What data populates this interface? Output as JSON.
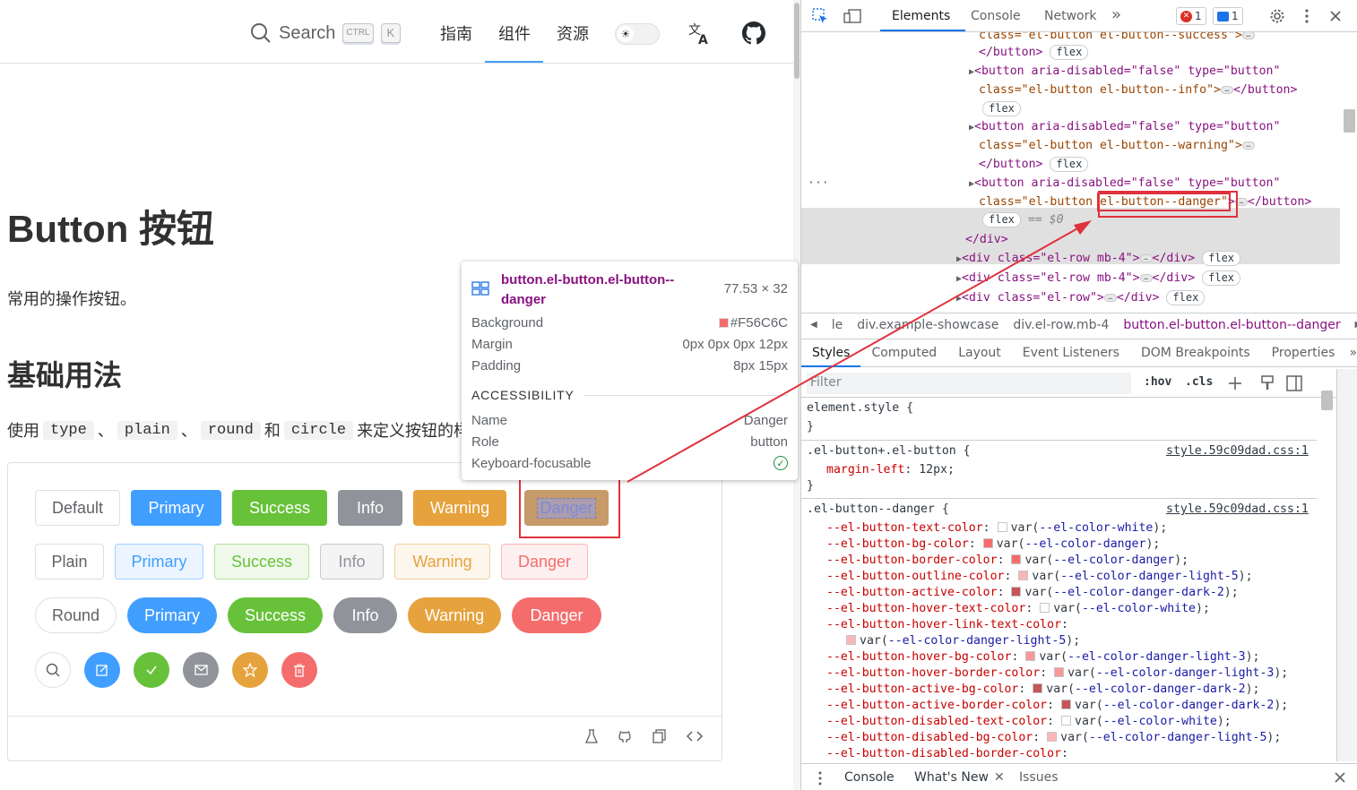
{
  "topbar": {
    "search_label": "Search",
    "kbd_ctrl": "CTRL",
    "kbd_k": "K",
    "nav": [
      "指南",
      "组件",
      "资源"
    ]
  },
  "page": {
    "title": "Button 按钮",
    "desc": "常用的操作按钮。",
    "section": "基础用法",
    "usage": {
      "prefix": "使用",
      "codes": [
        "type",
        "plain",
        "round",
        "circle"
      ],
      "sep1": "、",
      "sep2": "、",
      "sep3": "和",
      "suffix": "来定义按钮的样式"
    }
  },
  "buttons": {
    "row1": [
      "Default",
      "Primary",
      "Success",
      "Info",
      "Warning",
      "Danger"
    ],
    "row2": [
      "Plain",
      "Primary",
      "Success",
      "Info",
      "Warning",
      "Danger"
    ],
    "row3": [
      "Round",
      "Primary",
      "Success",
      "Info",
      "Warning",
      "Danger"
    ],
    "row4_icons": [
      "search-icon",
      "edit-icon",
      "check-icon",
      "message-icon",
      "star-icon",
      "delete-icon"
    ]
  },
  "colors": {
    "primary": "#409EFF",
    "success": "#67C23A",
    "info": "#909399",
    "warning": "#E6A23C",
    "danger": "#F56C6C",
    "annotation": "#E0323C"
  },
  "tooltip": {
    "selector": "button.el-button.el-button--danger",
    "size": "77.53 × 32",
    "background_label": "Background",
    "background_value": "#F56C6C",
    "margin_label": "Margin",
    "margin_value": "0px 0px 0px 12px",
    "padding_label": "Padding",
    "padding_value": "8px 15px",
    "accessibility": "ACCESSIBILITY",
    "name_label": "Name",
    "name_value": "Danger",
    "role_label": "Role",
    "role_value": "button",
    "focus_label": "Keyboard-focusable"
  },
  "devtools": {
    "tabs": [
      "Elements",
      "Console",
      "Network"
    ],
    "more": "»",
    "errors": "1",
    "messages": "1",
    "dom": {
      "l1": "class=\"el-button el-button--success\">",
      "l2": "</button>",
      "l3a": "<button aria-disabled=\"false\" type=\"button\"",
      "l3b": "class=\"el-button el-button--info\">",
      "l4a": "<button aria-disabled=\"false\" type=\"button\"",
      "l4b": "class=\"el-button el-button--warning\">",
      "l5a": "<button aria-disabled=\"false\" type=\"button\"",
      "l5b_1": "class=\"el-button",
      "l5b_2": "el-button--danger\"",
      "l5b_3": "</button>",
      "eq": "== $0",
      "l6": "</div>",
      "l7": "<div class=\"el-row mb-4\">",
      "l8": "<div class=\"el-row mb-4\">",
      "l9": "<div class=\"el-row\">",
      "close_div": "</div>",
      "close_btn": "</button>",
      "flex": "flex"
    },
    "crumbs": [
      "le",
      "div.example-showcase",
      "div.el-row.mb-4",
      "button.el-button.el-button--danger"
    ],
    "style_tabs": [
      "Styles",
      "Computed",
      "Layout",
      "Event Listeners",
      "DOM Breakpoints",
      "Properties"
    ],
    "filter_placeholder": "Filter",
    "hov": ":hov",
    "cls": ".cls",
    "rules": {
      "element_style": "element.style {",
      "close": "}",
      "r2_sel": ".el-button+.el-button {",
      "r2_src": "style.59c09dad.css:1",
      "r2_prop": "margin-left",
      "r2_val": "12px;",
      "r3_sel": ".el-button--danger {",
      "r3_src": "style.59c09dad.css:1",
      "r3_props": [
        {
          "p": "--el-button-text-color",
          "v": "--el-color-white",
          "c": "#FFFFFF"
        },
        {
          "p": "--el-button-bg-color",
          "v": "--el-color-danger",
          "c": "#F56C6C"
        },
        {
          "p": "--el-button-border-color",
          "v": "--el-color-danger",
          "c": "#F56C6C"
        },
        {
          "p": "--el-button-outline-color",
          "v": "--el-color-danger-light-5",
          "c": "#FAB6B6"
        },
        {
          "p": "--el-button-active-color",
          "v": "--el-color-danger-dark-2",
          "c": "#C45656"
        },
        {
          "p": "--el-button-hover-text-color",
          "v": "--el-color-white",
          "c": "#FFFFFF"
        },
        {
          "p": "--el-button-hover-link-text-color",
          "v": "--el-color-danger-light-5",
          "c": "#FAB6B6",
          "wrap": true
        },
        {
          "p": "--el-button-hover-bg-color",
          "v": "--el-color-danger-light-3",
          "c": "#F89898"
        },
        {
          "p": "--el-button-hover-border-color",
          "v": "--el-color-danger-light-3",
          "c": "#F89898"
        },
        {
          "p": "--el-button-active-bg-color",
          "v": "--el-color-danger-dark-2",
          "c": "#C45656"
        },
        {
          "p": "--el-button-active-border-color",
          "v": "--el-color-danger-dark-2",
          "c": "#C45656"
        },
        {
          "p": "--el-button-disabled-text-color",
          "v": "--el-color-white",
          "c": "#FFFFFF"
        },
        {
          "p": "--el-button-disabled-bg-color",
          "v": "--el-color-danger-light-5",
          "c": "#FAB6B6"
        },
        {
          "p": "--el-button-disabled-border-color",
          "v": "",
          "c": ""
        }
      ]
    },
    "drawer_tabs": [
      "Console",
      "What's New",
      "Issues"
    ]
  }
}
